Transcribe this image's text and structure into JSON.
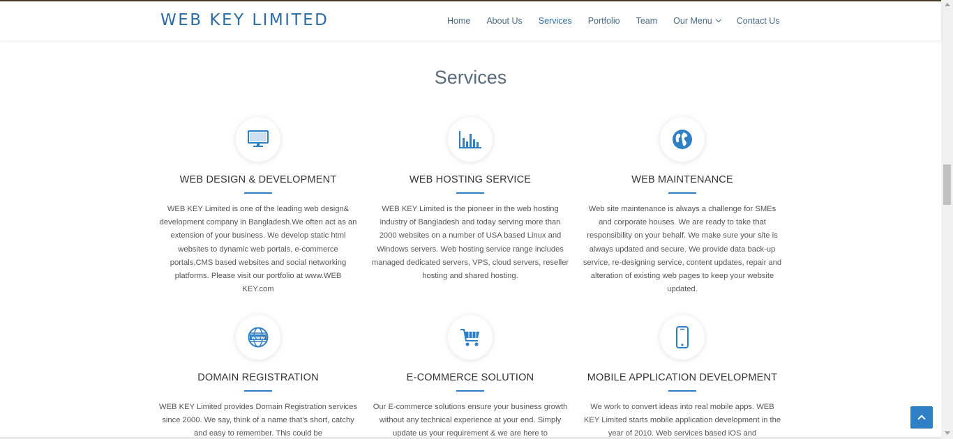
{
  "header": {
    "brand": "WEB KEY LIMITED",
    "nav": [
      {
        "label": "Home"
      },
      {
        "label": "About Us"
      },
      {
        "label": "Services"
      },
      {
        "label": "Portfolio"
      },
      {
        "label": "Team"
      },
      {
        "label": "Our Menu"
      },
      {
        "label": "Contact Us"
      }
    ],
    "active_nav": "Services"
  },
  "section": {
    "title": "Services"
  },
  "services": [
    {
      "icon": "monitor-icon",
      "title": "WEB DESIGN & DEVELOPMENT",
      "text": "WEB KEY Limited is one of the leading web design& development company in Bangladesh.We often act as an extension of your business. We develop static html websites to dynamic web portals, e-commerce portals,CMS based websites and social networking platforms. Please visit our portfolio at www.WEB KEY.com"
    },
    {
      "icon": "bar-chart-icon",
      "title": "WEB HOSTING SERVICE",
      "text": "WEB KEY Limited is the pioneer in the web hosting industry of Bangladesh and today serving more than 2000 websites on a number of USA based Linux and Windows servers. Web hosting service range includes managed dedicated servers, VPS, cloud servers, reseller hosting and shared hosting."
    },
    {
      "icon": "globe-icon",
      "title": "WEB MAINTENANCE",
      "text": "Web site maintenance is always a challenge for SMEs and corporate houses. We are ready to take that responsibility on your behalf. We make sure your site is always updated and secure. We provide data back-up service, re-designing service, content updates, repair and alteration of existing web pages to keep your website updated."
    },
    {
      "icon": "www-globe-icon",
      "title": "DOMAIN REGISTRATION",
      "text": "WEB KEY Limited provides Domain Registration services since 2000. We say, think of a name that's short, catchy and easy to remember. This could be"
    },
    {
      "icon": "shopping-cart-icon",
      "title": "E-COMMERCE SOLUTION",
      "text": "Our E-commerce solutions ensure your business growth without any technical experience at your end. Simply update us your requirement & we are here to"
    },
    {
      "icon": "mobile-phone-icon",
      "title": "MOBILE APPLICATION DEVELOPMENT",
      "text": "We work to convert ideas into real mobile apps. WEB KEY Limited starts mobile application development in the year of 2010. Web services based iOS and"
    }
  ],
  "colors": {
    "accent": "#2e7fc4",
    "brand": "#2e6da4",
    "title": "#5a6b7c"
  }
}
